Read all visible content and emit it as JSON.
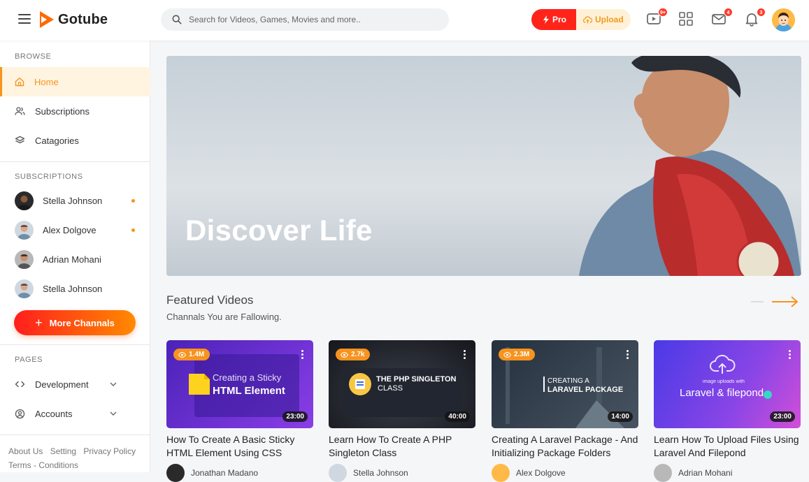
{
  "app": {
    "name": "Gotube"
  },
  "search": {
    "placeholder": "Search for Videos, Games, Movies and more.."
  },
  "header": {
    "pro_label": "Pro",
    "upload_label": "Upload",
    "video_badge": "9+",
    "mail_badge": "4",
    "bell_badge": "3"
  },
  "sidebar": {
    "browse_title": "BROWSE",
    "browse": [
      {
        "label": "Home",
        "icon": "home-icon"
      },
      {
        "label": "Subscriptions",
        "icon": "users-icon"
      },
      {
        "label": "Catagories",
        "icon": "layers-icon"
      }
    ],
    "subs_title": "SUBSCRIPTIONS",
    "subs": [
      {
        "name": "Stella Johnson",
        "new": true
      },
      {
        "name": "Alex Dolgove",
        "new": true
      },
      {
        "name": "Adrian Mohani",
        "new": false
      },
      {
        "name": "Stella Johnson",
        "new": false
      }
    ],
    "more_label": "More Channals",
    "pages_title": "PAGES",
    "pages": [
      {
        "label": "Development",
        "icon": "code-icon"
      },
      {
        "label": "Accounts",
        "icon": "user-circle-icon"
      }
    ],
    "footer": [
      "About Us",
      "Setting",
      "Privacy Policy",
      "Terms - Conditions"
    ]
  },
  "hero": {
    "title": "Discover Life"
  },
  "featured": {
    "title": "Featured Videos",
    "subtitle": "Channals You are Fallowing."
  },
  "videos": [
    {
      "views": "1.4M",
      "duration": "23:00",
      "title": "How To Create A Basic Sticky HTML Element Using CSS",
      "author": "Jonathan Madano",
      "thumb_line1": "Creating a Sticky",
      "thumb_line2": "HTML Element",
      "color1": "#5b2ac8",
      "color2": "#8b3fe0"
    },
    {
      "views": "2.7k",
      "duration": "40:00",
      "title": "Learn How To Create A PHP Singleton Class",
      "author": "Stella Johnson",
      "thumb_line1": "THE PHP SINGLETON",
      "thumb_line2": "CLASS",
      "color1": "#1c1f26",
      "color2": "#3a3f49"
    },
    {
      "views": "2.3M",
      "duration": "14:00",
      "title": "Creating A Laravel Package - And Initializing Package Folders",
      "author": "Alex Dolgove",
      "thumb_line1": "CREATING A",
      "thumb_line2": "LARAVEL PACKAGE",
      "color1": "#2c3a4a",
      "color2": "#5a6b7a"
    },
    {
      "views": "",
      "duration": "23:00",
      "title": "Learn How To Upload Files Using Laravel And Filepond",
      "author": "Adrian Mohani",
      "thumb_line1": "image uploads with",
      "thumb_line2": "Laravel & filepond",
      "color1": "#5a3de8",
      "color2": "#c24ee0"
    }
  ]
}
